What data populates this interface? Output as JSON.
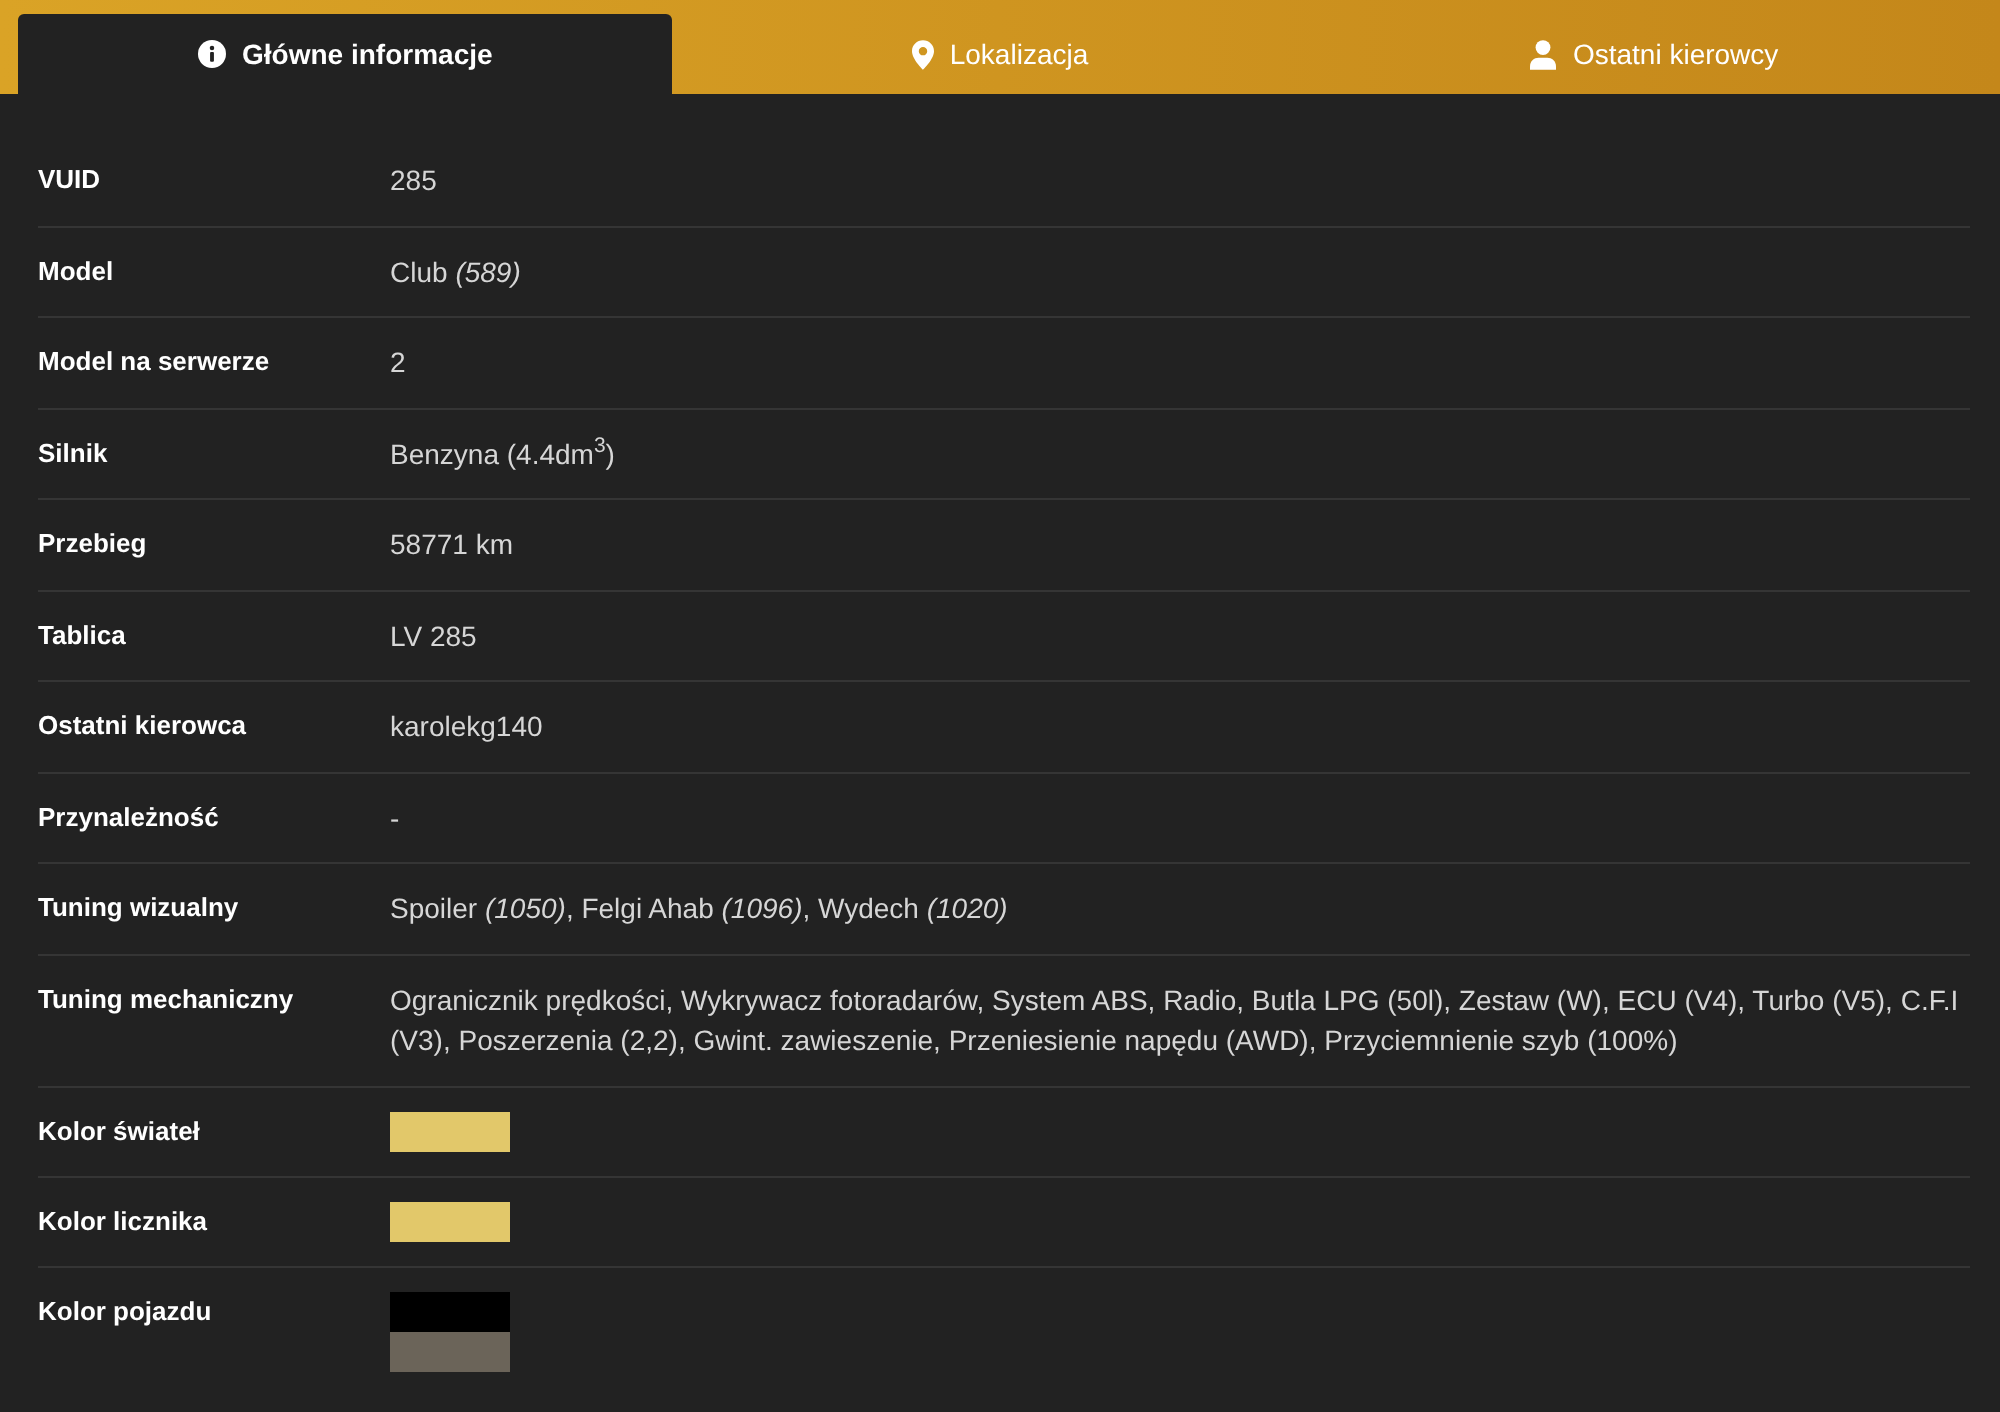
{
  "tabs": [
    {
      "label": "Główne informacje",
      "selected": true
    },
    {
      "label": "Lokalizacja",
      "selected": false
    },
    {
      "label": "Ostatni kierowcy",
      "selected": false
    }
  ],
  "rows": [
    {
      "kind": "text",
      "label": "VUID",
      "value": "285"
    },
    {
      "kind": "text",
      "label": "Model",
      "value": "Club *(589)*"
    },
    {
      "kind": "text",
      "label": "Model na serwerze",
      "value": "2"
    },
    {
      "kind": "text",
      "label": "Silnik",
      "value": "Benzyna (4.4dm$^{3}$)"
    },
    {
      "kind": "text",
      "label": "Przebieg",
      "value": "58771 km"
    },
    {
      "kind": "text",
      "label": "Tablica",
      "value": "LV 285"
    },
    {
      "kind": "text",
      "label": "Ostatni kierowca",
      "value": "karolekg140"
    },
    {
      "kind": "text",
      "label": "Przynależność",
      "value": "-"
    },
    {
      "kind": "text",
      "label": "Tuning wizualny",
      "value": "Spoiler *(1050)*, Felgi Ahab *(1096)*, Wydech *(1020)*"
    },
    {
      "kind": "text",
      "label": "Tuning mechaniczny",
      "value": "Ogranicznik prędkości, Wykrywacz fotoradarów, System ABS, Radio, Butla LPG (50l), Zestaw (W), ECU (V4), Turbo (V5), C.F.I (V3), Poszerzenia (2,2), Gwint. zawieszenie, Przeniesienie napędu (AWD), Przyciemnienie szyb (100%)"
    },
    {
      "kind": "color",
      "label": "Kolor świateł",
      "swatches": [
        {
          "color": "#e2c86a"
        }
      ]
    },
    {
      "kind": "color",
      "label": "Kolor licznika",
      "swatches": [
        {
          "color": "#e2c86a"
        }
      ]
    },
    {
      "kind": "color",
      "label": "Kolor pojazdu",
      "swatches": [
        {
          "color": "#000000"
        },
        {
          "color": "#6b6459"
        }
      ]
    }
  ]
}
